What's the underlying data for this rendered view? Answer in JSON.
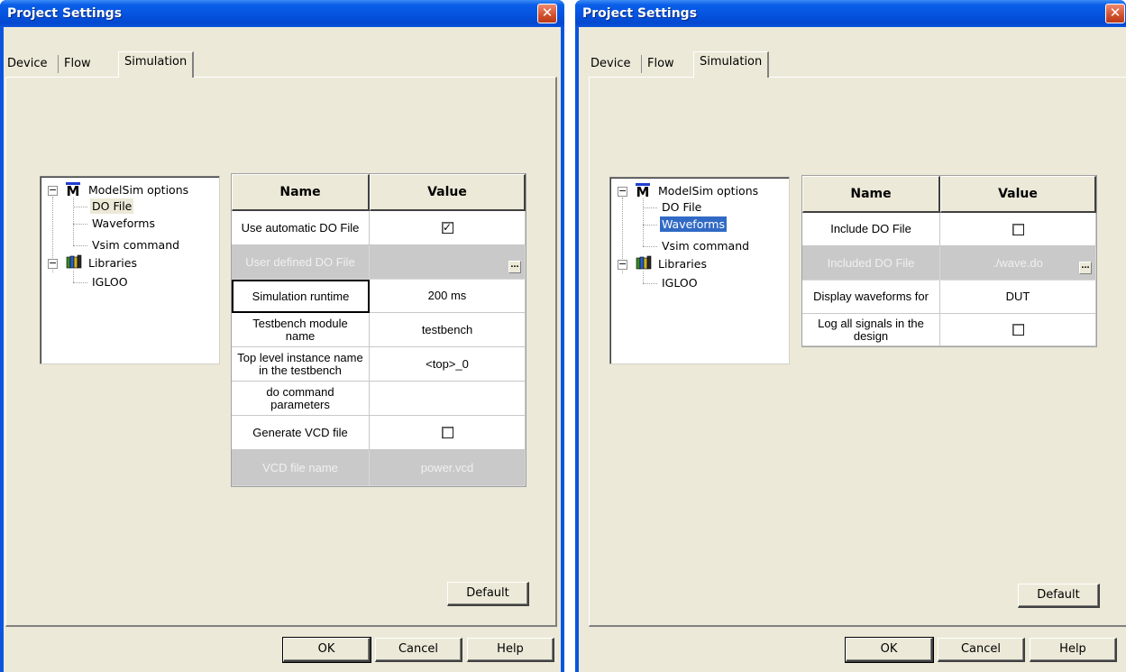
{
  "left_window": {
    "title": "Project Settings",
    "close_glyph": "✕",
    "tabs": [
      "Device",
      "Flow",
      "Simulation"
    ],
    "active_tab": "Simulation",
    "tree": {
      "root_label": "ModelSim options",
      "root_icon": "modelsim-m-icon",
      "children": [
        "DO File",
        "Waveforms",
        "Vsim command"
      ],
      "libraries_label": "Libraries",
      "libraries_icon": "books-icon",
      "library_children": [
        "IGLOO"
      ],
      "selected": "DO File"
    },
    "grid": {
      "header_name": "Name",
      "header_value": "Value",
      "rows": [
        {
          "name": "Use automatic DO File",
          "value": "",
          "checkbox": true,
          "checked": true
        },
        {
          "name": "User defined DO File",
          "value": "",
          "disabled": true,
          "browse": "..."
        },
        {
          "name": "Simulation runtime",
          "value": "200 ms"
        },
        {
          "name": "Testbench module name",
          "value": "testbench"
        },
        {
          "name": "Top level instance name in the testbench",
          "value": "<top>_0"
        },
        {
          "name": "do command parameters",
          "value": ""
        },
        {
          "name": "Generate VCD file",
          "value": "",
          "checkbox": true,
          "checked": false
        },
        {
          "name": "VCD file name",
          "value": "power.vcd",
          "disabled": true
        }
      ]
    },
    "buttons": {
      "default": "Default",
      "ok": "OK",
      "cancel": "Cancel",
      "help": "Help"
    }
  },
  "right_window": {
    "title": "Project Settings",
    "close_glyph": "✕",
    "tabs": [
      "Device",
      "Flow",
      "Simulation"
    ],
    "active_tab": "Simulation",
    "tree": {
      "root_label": "ModelSim options",
      "children": [
        "DO File",
        "Waveforms",
        "Vsim command"
      ],
      "libraries_label": "Libraries",
      "library_children": [
        "IGLOO"
      ],
      "selected": "Waveforms"
    },
    "grid": {
      "header_name": "Name",
      "header_value": "Value",
      "rows": [
        {
          "name": "Include DO File",
          "value": "",
          "checkbox": true,
          "checked": false
        },
        {
          "name": "Included DO File",
          "value": "./wave.do",
          "disabled": true,
          "browse": "..."
        },
        {
          "name": "Display waveforms for",
          "value": "DUT"
        },
        {
          "name": "Log all signals in the design",
          "value": "",
          "checkbox": true,
          "checked": false
        }
      ]
    },
    "buttons": {
      "default": "Default",
      "ok": "OK",
      "cancel": "Cancel",
      "help": "Help"
    }
  },
  "colors": {
    "titlebar": "#0553e0",
    "dialog_face": "#ece9d8",
    "selection": "#316ac5",
    "disabled_cell": "#c9c9c9",
    "close_button": "#d0502c"
  }
}
